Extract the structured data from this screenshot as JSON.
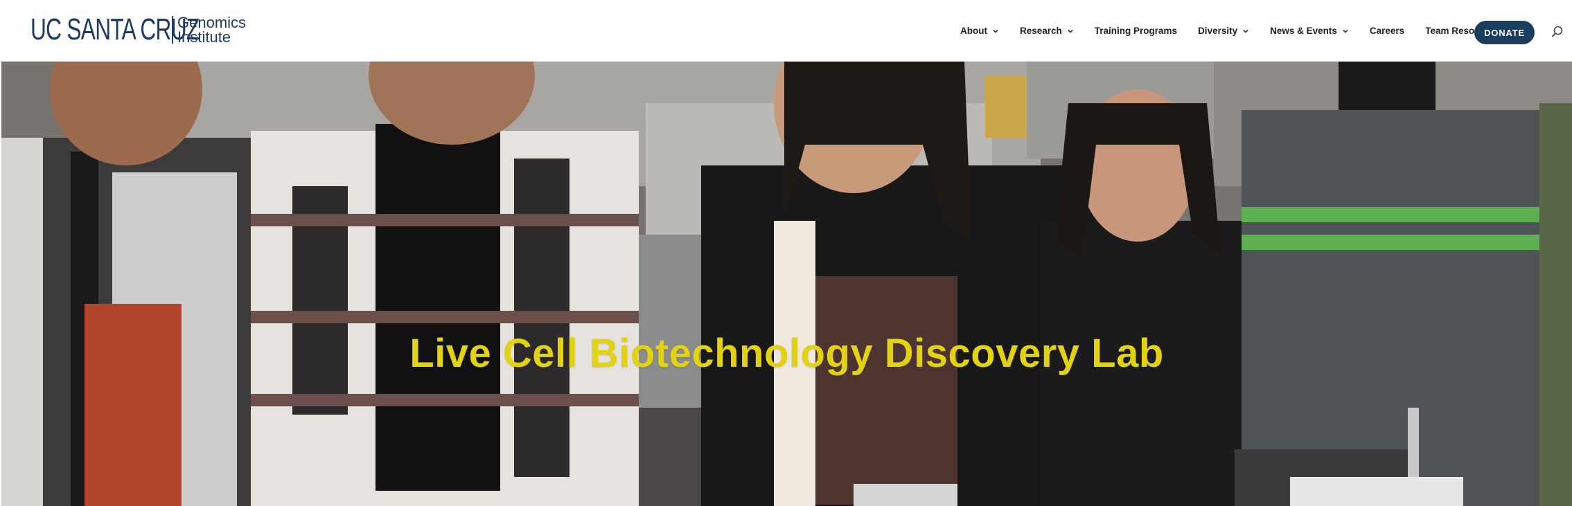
{
  "brand": {
    "logo_main": "UC SANTA CRUZ",
    "logo_sub_line1": "Genomics",
    "logo_sub_line2": "Institute",
    "color": "#1f3b64"
  },
  "nav": {
    "items": [
      {
        "label": "About",
        "has_dropdown": true
      },
      {
        "label": "Research",
        "has_dropdown": true
      },
      {
        "label": "Training Programs",
        "has_dropdown": false
      },
      {
        "label": "Diversity",
        "has_dropdown": true
      },
      {
        "label": "News & Events",
        "has_dropdown": true
      },
      {
        "label": "Careers",
        "has_dropdown": false
      },
      {
        "label": "Team Resources",
        "has_dropdown": false
      }
    ],
    "donate_label": "DONATE",
    "donate_color": "#1c3e5e",
    "search_icon": "search-icon"
  },
  "hero": {
    "title": "Live Cell Biotechnology Discovery Lab",
    "title_color": "#e2d20f",
    "image_description_icon": "group-of-students-photo"
  }
}
